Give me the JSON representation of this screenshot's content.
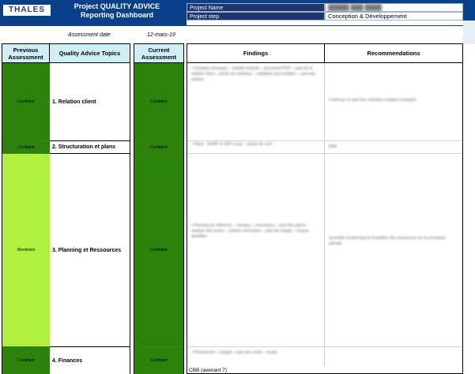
{
  "header": {
    "logo_text": "THALES",
    "title_line1": "Project QUALITY ADVICE",
    "title_line2": "Reporting Dashboard",
    "project_name_label": "Project Name",
    "project_name_value": "█████ ███ ████",
    "project_step_label": "Project step",
    "project_step_value": "Conception & Développement"
  },
  "assessment": {
    "date_label": "Assessment date",
    "date_value": "12-mars-19"
  },
  "columns": {
    "previous": "Previous Assessment",
    "topics": "Quality Advice Topics",
    "current": "Current Assessment",
    "findings": "Findings",
    "recommendations": "Recommendations"
  },
  "rows": [
    {
      "previous": "Confident",
      "topic": "1. Relation client",
      "current": "Confident",
      "findings": "▪ Comptes échangés – activité réalisée – document PVR – suivi de la relation client – points de synthèse – validation des livrables – suivi des actions",
      "recommendations": "Continuer le suivi des activités comptes échangés"
    },
    {
      "previous": "Confident",
      "topic": "2. Structuration et plans",
      "current": "Confident",
      "findings": "▪ Plans : SDMP et SDP à jour – points de suivi",
      "recommendations": "RAS"
    },
    {
      "previous": "Monitored",
      "topic": "3. Planning et Ressources",
      "current": "Confident",
      "findings": "▪ Planning de référence – charges – ressources – suivi des jalons – analyse des écarts – actions correctives – plan de charge – risques identifiés",
      "recommendations": "Surveiller le planning et l'évolution des ressources sur la prochaine période"
    },
    {
      "previous": "Confident",
      "topic": "4. Finances",
      "current": "Confident",
      "findings": "▪ Prévisionnel – budget – suivi des coûts – écarts",
      "recommendations": ""
    }
  ],
  "footer_note": "CBB (avenant 7)",
  "colors": {
    "header_band": "#0a3f8a",
    "status_confident": "#2b830c",
    "status_monitored": "#b2f040",
    "column_header_bg": "#cdeff5"
  }
}
